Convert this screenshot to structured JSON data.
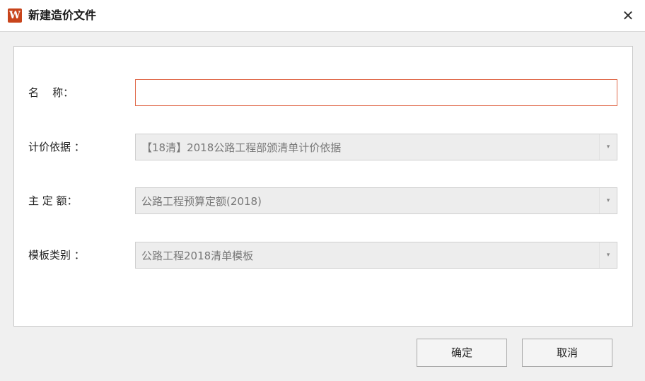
{
  "window": {
    "logo_letter": "W",
    "title": "新建造价文件",
    "close_glyph": "✕"
  },
  "form": {
    "name": {
      "label": "名    称：",
      "value": ""
    },
    "pricing_basis": {
      "label": "计价依据 ：",
      "value": "【18清】2018公路工程部颁清单计价依据"
    },
    "main_quota": {
      "label": "主 定 额：",
      "value": "公路工程预算定额(2018)"
    },
    "template_type": {
      "label": "模板类别 ：",
      "value": "公路工程2018清单模板"
    },
    "dropdown_icon": "▾"
  },
  "buttons": {
    "ok": "确定",
    "cancel": "取消"
  },
  "colors": {
    "logo_bg": "#c8441b",
    "active_input_border": "#e06a4b"
  }
}
